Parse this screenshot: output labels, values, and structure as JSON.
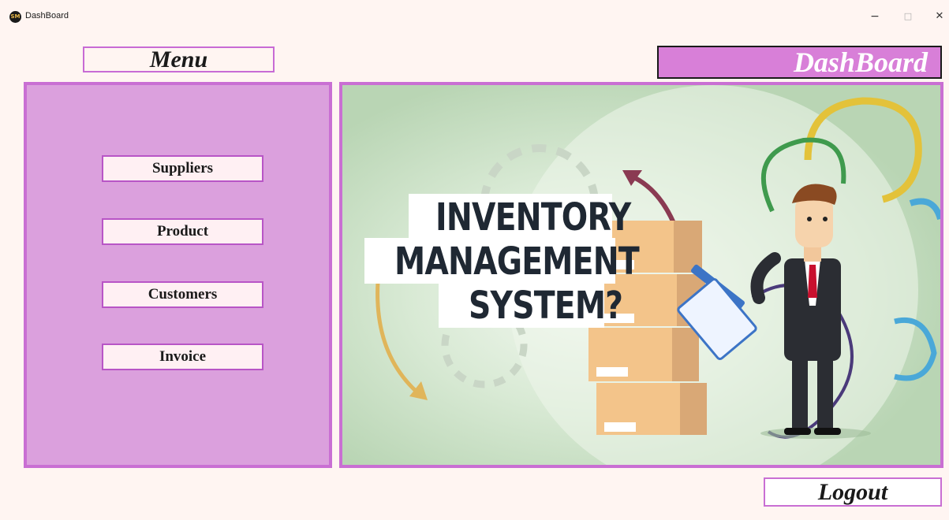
{
  "window": {
    "title": "DashBoard",
    "app_icon_text": "SM",
    "minimize": "−",
    "maximize": "□",
    "close": "✕"
  },
  "headings": {
    "menu": "Menu",
    "dashboard": "DashBoard"
  },
  "sidebar": {
    "items": [
      {
        "label": "Suppliers"
      },
      {
        "label": "Product"
      },
      {
        "label": "Customers"
      },
      {
        "label": "Invoice"
      }
    ]
  },
  "hero": {
    "line1": "INVENTORY",
    "line2": "MANAGEMENT",
    "line3": "SYSTEM?"
  },
  "footer": {
    "logout": "Logout"
  },
  "colors": {
    "background": "#fff5f2",
    "sidebar": "#dba0dd",
    "accent_border": "#c96fd3",
    "dashboard_heading_bg": "#d87fd8"
  }
}
